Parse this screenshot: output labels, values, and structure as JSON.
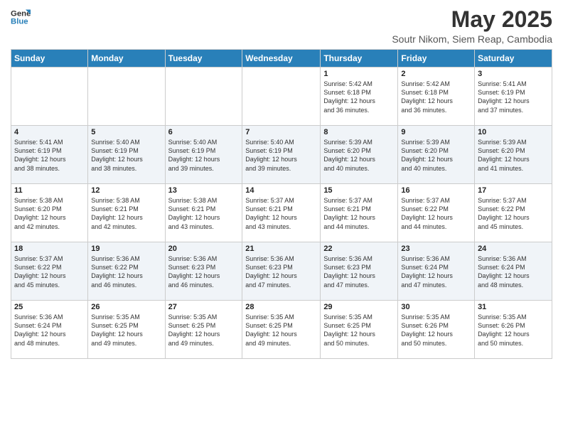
{
  "header": {
    "logo_line1": "General",
    "logo_line2": "Blue",
    "month_title": "May 2025",
    "subtitle": "Soutr Nikom, Siem Reap, Cambodia"
  },
  "days_of_week": [
    "Sunday",
    "Monday",
    "Tuesday",
    "Wednesday",
    "Thursday",
    "Friday",
    "Saturday"
  ],
  "weeks": [
    [
      {
        "day": "",
        "info": ""
      },
      {
        "day": "",
        "info": ""
      },
      {
        "day": "",
        "info": ""
      },
      {
        "day": "",
        "info": ""
      },
      {
        "day": "1",
        "info": "Sunrise: 5:42 AM\nSunset: 6:18 PM\nDaylight: 12 hours\nand 36 minutes."
      },
      {
        "day": "2",
        "info": "Sunrise: 5:42 AM\nSunset: 6:18 PM\nDaylight: 12 hours\nand 36 minutes."
      },
      {
        "day": "3",
        "info": "Sunrise: 5:41 AM\nSunset: 6:19 PM\nDaylight: 12 hours\nand 37 minutes."
      }
    ],
    [
      {
        "day": "4",
        "info": "Sunrise: 5:41 AM\nSunset: 6:19 PM\nDaylight: 12 hours\nand 38 minutes."
      },
      {
        "day": "5",
        "info": "Sunrise: 5:40 AM\nSunset: 6:19 PM\nDaylight: 12 hours\nand 38 minutes."
      },
      {
        "day": "6",
        "info": "Sunrise: 5:40 AM\nSunset: 6:19 PM\nDaylight: 12 hours\nand 39 minutes."
      },
      {
        "day": "7",
        "info": "Sunrise: 5:40 AM\nSunset: 6:19 PM\nDaylight: 12 hours\nand 39 minutes."
      },
      {
        "day": "8",
        "info": "Sunrise: 5:39 AM\nSunset: 6:20 PM\nDaylight: 12 hours\nand 40 minutes."
      },
      {
        "day": "9",
        "info": "Sunrise: 5:39 AM\nSunset: 6:20 PM\nDaylight: 12 hours\nand 40 minutes."
      },
      {
        "day": "10",
        "info": "Sunrise: 5:39 AM\nSunset: 6:20 PM\nDaylight: 12 hours\nand 41 minutes."
      }
    ],
    [
      {
        "day": "11",
        "info": "Sunrise: 5:38 AM\nSunset: 6:20 PM\nDaylight: 12 hours\nand 42 minutes."
      },
      {
        "day": "12",
        "info": "Sunrise: 5:38 AM\nSunset: 6:21 PM\nDaylight: 12 hours\nand 42 minutes."
      },
      {
        "day": "13",
        "info": "Sunrise: 5:38 AM\nSunset: 6:21 PM\nDaylight: 12 hours\nand 43 minutes."
      },
      {
        "day": "14",
        "info": "Sunrise: 5:37 AM\nSunset: 6:21 PM\nDaylight: 12 hours\nand 43 minutes."
      },
      {
        "day": "15",
        "info": "Sunrise: 5:37 AM\nSunset: 6:21 PM\nDaylight: 12 hours\nand 44 minutes."
      },
      {
        "day": "16",
        "info": "Sunrise: 5:37 AM\nSunset: 6:22 PM\nDaylight: 12 hours\nand 44 minutes."
      },
      {
        "day": "17",
        "info": "Sunrise: 5:37 AM\nSunset: 6:22 PM\nDaylight: 12 hours\nand 45 minutes."
      }
    ],
    [
      {
        "day": "18",
        "info": "Sunrise: 5:37 AM\nSunset: 6:22 PM\nDaylight: 12 hours\nand 45 minutes."
      },
      {
        "day": "19",
        "info": "Sunrise: 5:36 AM\nSunset: 6:22 PM\nDaylight: 12 hours\nand 46 minutes."
      },
      {
        "day": "20",
        "info": "Sunrise: 5:36 AM\nSunset: 6:23 PM\nDaylight: 12 hours\nand 46 minutes."
      },
      {
        "day": "21",
        "info": "Sunrise: 5:36 AM\nSunset: 6:23 PM\nDaylight: 12 hours\nand 47 minutes."
      },
      {
        "day": "22",
        "info": "Sunrise: 5:36 AM\nSunset: 6:23 PM\nDaylight: 12 hours\nand 47 minutes."
      },
      {
        "day": "23",
        "info": "Sunrise: 5:36 AM\nSunset: 6:24 PM\nDaylight: 12 hours\nand 47 minutes."
      },
      {
        "day": "24",
        "info": "Sunrise: 5:36 AM\nSunset: 6:24 PM\nDaylight: 12 hours\nand 48 minutes."
      }
    ],
    [
      {
        "day": "25",
        "info": "Sunrise: 5:36 AM\nSunset: 6:24 PM\nDaylight: 12 hours\nand 48 minutes."
      },
      {
        "day": "26",
        "info": "Sunrise: 5:35 AM\nSunset: 6:25 PM\nDaylight: 12 hours\nand 49 minutes."
      },
      {
        "day": "27",
        "info": "Sunrise: 5:35 AM\nSunset: 6:25 PM\nDaylight: 12 hours\nand 49 minutes."
      },
      {
        "day": "28",
        "info": "Sunrise: 5:35 AM\nSunset: 6:25 PM\nDaylight: 12 hours\nand 49 minutes."
      },
      {
        "day": "29",
        "info": "Sunrise: 5:35 AM\nSunset: 6:25 PM\nDaylight: 12 hours\nand 50 minutes."
      },
      {
        "day": "30",
        "info": "Sunrise: 5:35 AM\nSunset: 6:26 PM\nDaylight: 12 hours\nand 50 minutes."
      },
      {
        "day": "31",
        "info": "Sunrise: 5:35 AM\nSunset: 6:26 PM\nDaylight: 12 hours\nand 50 minutes."
      }
    ]
  ]
}
